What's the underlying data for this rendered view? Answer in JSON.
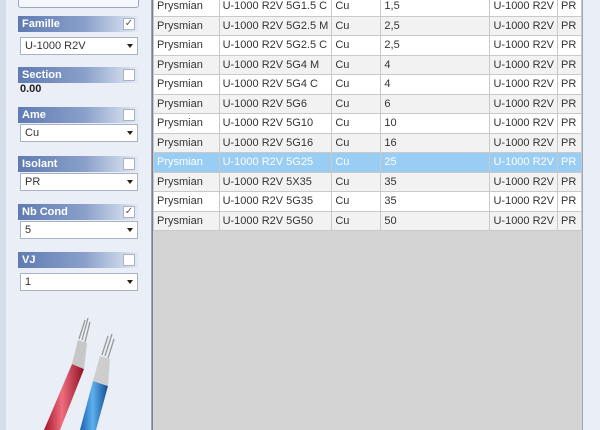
{
  "filters": {
    "famille": {
      "label": "Famille",
      "checked": true,
      "value": "U-1000 R2V"
    },
    "section": {
      "label": "Section",
      "checked": false,
      "value": "0.00"
    },
    "ame": {
      "label": "Ame",
      "checked": false,
      "value": "Cu"
    },
    "isolant": {
      "label": "Isolant",
      "checked": false,
      "value": "PR"
    },
    "nb_cond": {
      "label": "Nb Cond",
      "checked": true,
      "value": "5"
    },
    "vj": {
      "label": "VJ",
      "checked": false,
      "value": "1"
    }
  },
  "illustration": "cable-illustration",
  "table": {
    "rows": [
      {
        "cells": [
          "Prysmian",
          "U-1000 R2V 5G1.5 C",
          "Cu",
          "1,5",
          "U-1000 R2V",
          "PR"
        ]
      },
      {
        "cells": [
          "Prysmian",
          "U-1000 R2V 5G2.5 M",
          "Cu",
          "2,5",
          "U-1000 R2V",
          "PR"
        ]
      },
      {
        "cells": [
          "Prysmian",
          "U-1000 R2V 5G2.5 C",
          "Cu",
          "2,5",
          "U-1000 R2V",
          "PR"
        ]
      },
      {
        "cells": [
          "Prysmian",
          "U-1000 R2V 5G4 M",
          "Cu",
          "4",
          "U-1000 R2V",
          "PR"
        ]
      },
      {
        "cells": [
          "Prysmian",
          "U-1000 R2V 5G4 C",
          "Cu",
          "4",
          "U-1000 R2V",
          "PR"
        ]
      },
      {
        "cells": [
          "Prysmian",
          "U-1000 R2V 5G6",
          "Cu",
          "6",
          "U-1000 R2V",
          "PR"
        ]
      },
      {
        "cells": [
          "Prysmian",
          "U-1000 R2V 5G10",
          "Cu",
          "10",
          "U-1000 R2V",
          "PR"
        ]
      },
      {
        "cells": [
          "Prysmian",
          "U-1000 R2V 5G16",
          "Cu",
          "16",
          "U-1000 R2V",
          "PR"
        ]
      },
      {
        "cells": [
          "Prysmian",
          "U-1000 R2V 5G25",
          "Cu",
          "25",
          "U-1000 R2V",
          "PR"
        ],
        "selected": true
      },
      {
        "cells": [
          "Prysmian",
          "U-1000 R2V 5X35",
          "Cu",
          "35",
          "U-1000 R2V",
          "PR"
        ]
      },
      {
        "cells": [
          "Prysmian",
          "U-1000 R2V 5G35",
          "Cu",
          "35",
          "U-1000 R2V",
          "PR"
        ]
      },
      {
        "cells": [
          "Prysmian",
          "U-1000 R2V 5G50",
          "Cu",
          "50",
          "U-1000 R2V",
          "PR"
        ]
      }
    ]
  }
}
